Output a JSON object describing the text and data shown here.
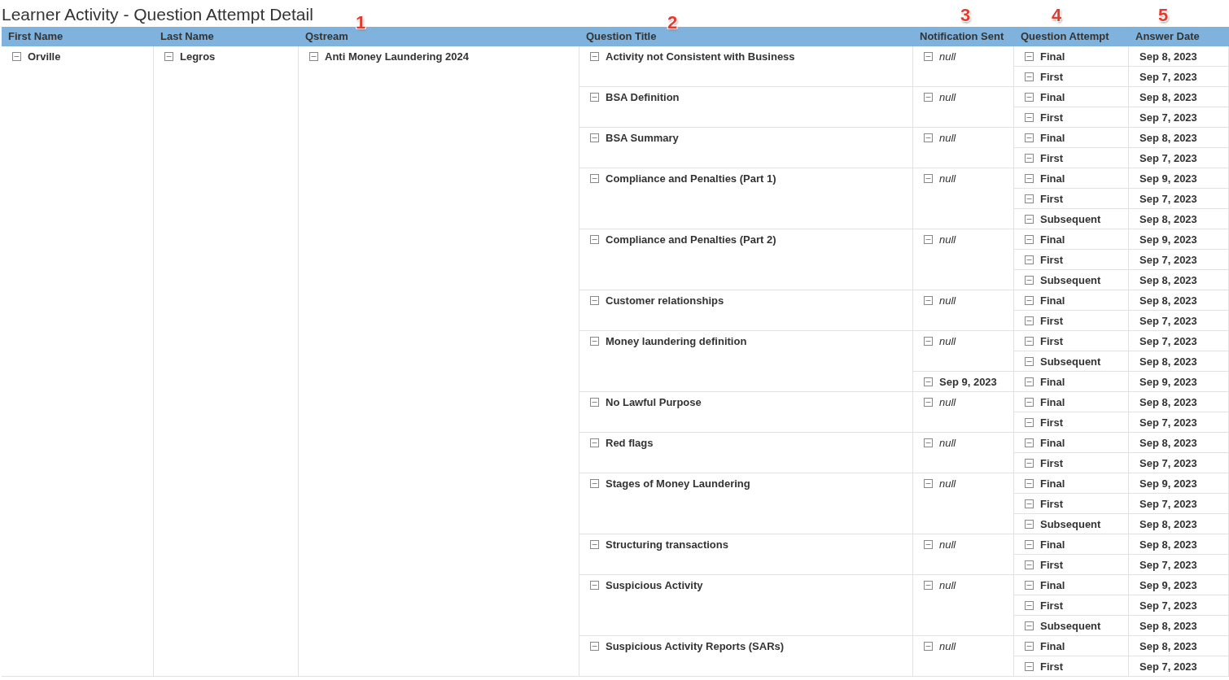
{
  "title": "Learner Activity - Question Attempt Detail",
  "columns": [
    {
      "label": "First Name"
    },
    {
      "label": "Last Name"
    },
    {
      "label": "Qstream",
      "callout": "1"
    },
    {
      "label": "Question Title",
      "callout": "2"
    },
    {
      "label": "Notification Sent",
      "callout": "3"
    },
    {
      "label": "Question Attempt",
      "callout": "4"
    },
    {
      "label": "Answer Date",
      "callout": "5"
    }
  ],
  "learner": {
    "first_name": "Orville",
    "last_name": "Legros",
    "qstream": "Anti Money Laundering 2024",
    "questions": [
      {
        "title": "Activity not Consistent with Business",
        "notifications": [
          {
            "kind": "null",
            "value": "null",
            "attempts": [
              {
                "attempt": "Final",
                "date": "Sep 8, 2023"
              },
              {
                "attempt": "First",
                "date": "Sep 7, 2023"
              }
            ]
          }
        ]
      },
      {
        "title": "BSA Definition",
        "notifications": [
          {
            "kind": "null",
            "value": "null",
            "attempts": [
              {
                "attempt": "Final",
                "date": "Sep 8, 2023"
              },
              {
                "attempt": "First",
                "date": "Sep 7, 2023"
              }
            ]
          }
        ]
      },
      {
        "title": "BSA Summary",
        "notifications": [
          {
            "kind": "null",
            "value": "null",
            "attempts": [
              {
                "attempt": "Final",
                "date": "Sep 8, 2023"
              },
              {
                "attempt": "First",
                "date": "Sep 7, 2023"
              }
            ]
          }
        ]
      },
      {
        "title": "Compliance and Penalties (Part 1)",
        "notifications": [
          {
            "kind": "null",
            "value": "null",
            "attempts": [
              {
                "attempt": "Final",
                "date": "Sep 9, 2023"
              },
              {
                "attempt": "First",
                "date": "Sep 7, 2023"
              },
              {
                "attempt": "Subsequent",
                "date": "Sep 8, 2023"
              }
            ]
          }
        ]
      },
      {
        "title": "Compliance and Penalties (Part 2)",
        "notifications": [
          {
            "kind": "null",
            "value": "null",
            "attempts": [
              {
                "attempt": "Final",
                "date": "Sep 9, 2023"
              },
              {
                "attempt": "First",
                "date": "Sep 7, 2023"
              },
              {
                "attempt": "Subsequent",
                "date": "Sep 8, 2023"
              }
            ]
          }
        ]
      },
      {
        "title": "Customer relationships",
        "notifications": [
          {
            "kind": "null",
            "value": "null",
            "attempts": [
              {
                "attempt": "Final",
                "date": "Sep 8, 2023"
              },
              {
                "attempt": "First",
                "date": "Sep 7, 2023"
              }
            ]
          }
        ]
      },
      {
        "title": "Money laundering definition",
        "notifications": [
          {
            "kind": "null",
            "value": "null",
            "attempts": [
              {
                "attempt": "First",
                "date": "Sep 7, 2023"
              },
              {
                "attempt": "Subsequent",
                "date": "Sep 8, 2023"
              }
            ]
          },
          {
            "kind": "date",
            "value": "Sep 9, 2023",
            "attempts": [
              {
                "attempt": "Final",
                "date": "Sep 9, 2023"
              }
            ]
          }
        ]
      },
      {
        "title": "No Lawful Purpose",
        "notifications": [
          {
            "kind": "null",
            "value": "null",
            "attempts": [
              {
                "attempt": "Final",
                "date": "Sep 8, 2023"
              },
              {
                "attempt": "First",
                "date": "Sep 7, 2023"
              }
            ]
          }
        ]
      },
      {
        "title": "Red flags",
        "notifications": [
          {
            "kind": "null",
            "value": "null",
            "attempts": [
              {
                "attempt": "Final",
                "date": "Sep 8, 2023"
              },
              {
                "attempt": "First",
                "date": "Sep 7, 2023"
              }
            ]
          }
        ]
      },
      {
        "title": "Stages of Money Laundering",
        "notifications": [
          {
            "kind": "null",
            "value": "null",
            "attempts": [
              {
                "attempt": "Final",
                "date": "Sep 9, 2023"
              },
              {
                "attempt": "First",
                "date": "Sep 7, 2023"
              },
              {
                "attempt": "Subsequent",
                "date": "Sep 8, 2023"
              }
            ]
          }
        ]
      },
      {
        "title": "Structuring transactions",
        "notifications": [
          {
            "kind": "null",
            "value": "null",
            "attempts": [
              {
                "attempt": "Final",
                "date": "Sep 8, 2023"
              },
              {
                "attempt": "First",
                "date": "Sep 7, 2023"
              }
            ]
          }
        ]
      },
      {
        "title": "Suspicious Activity",
        "notifications": [
          {
            "kind": "null",
            "value": "null",
            "attempts": [
              {
                "attempt": "Final",
                "date": "Sep 9, 2023"
              },
              {
                "attempt": "First",
                "date": "Sep 7, 2023"
              },
              {
                "attempt": "Subsequent",
                "date": "Sep 8, 2023"
              }
            ]
          }
        ]
      },
      {
        "title": "Suspicious Activity Reports (SARs)",
        "notifications": [
          {
            "kind": "null",
            "value": "null",
            "attempts": [
              {
                "attempt": "Final",
                "date": "Sep 8, 2023"
              },
              {
                "attempt": "First",
                "date": "Sep 7, 2023"
              }
            ]
          }
        ]
      }
    ]
  }
}
